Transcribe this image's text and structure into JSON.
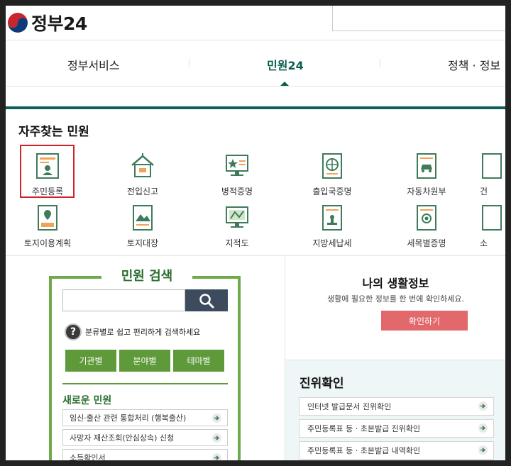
{
  "header": {
    "logo_text": "정부24"
  },
  "nav": {
    "items": [
      "정부서비스",
      "민원24",
      "정책 · 정보"
    ]
  },
  "frequent": {
    "title": "자주찾는 민원",
    "row1": [
      "주민등록",
      "전입신고",
      "병적증명",
      "출입국증명",
      "자동차원부",
      "건"
    ],
    "row2": [
      "토지이용계획",
      "토지대장",
      "지적도",
      "지방세납세",
      "세목별증명",
      "소"
    ]
  },
  "search": {
    "title": "민원 검색",
    "help_icon_char": "?",
    "help_text": "분류별로 쉽고 편리하게 검색하세요",
    "categories": [
      "기관별",
      "분야별",
      "테마별"
    ]
  },
  "new_civil": {
    "title": "새로운 민원",
    "items": [
      "임신·출산 관련 통합처리 (행복출산)",
      "사망자 재산조회(안심상속) 신청",
      "소득확인서"
    ]
  },
  "life_info": {
    "title": "나의 생활정보",
    "subtitle": "생활에 필요한 정보를 한 번에 확인하세요.",
    "button": "확인하기"
  },
  "verify": {
    "title": "진위확인",
    "items": [
      "인터넷 발급문서 진위확인",
      "주민등록표 등 · 초본발급 진위확인",
      "주민등록표 등 · 초본발급 내역확인"
    ]
  },
  "colors": {
    "accent": "#0d5f58",
    "green": "#5e9a3a",
    "pink": "#e2686c",
    "highlight": "#d0202a"
  }
}
